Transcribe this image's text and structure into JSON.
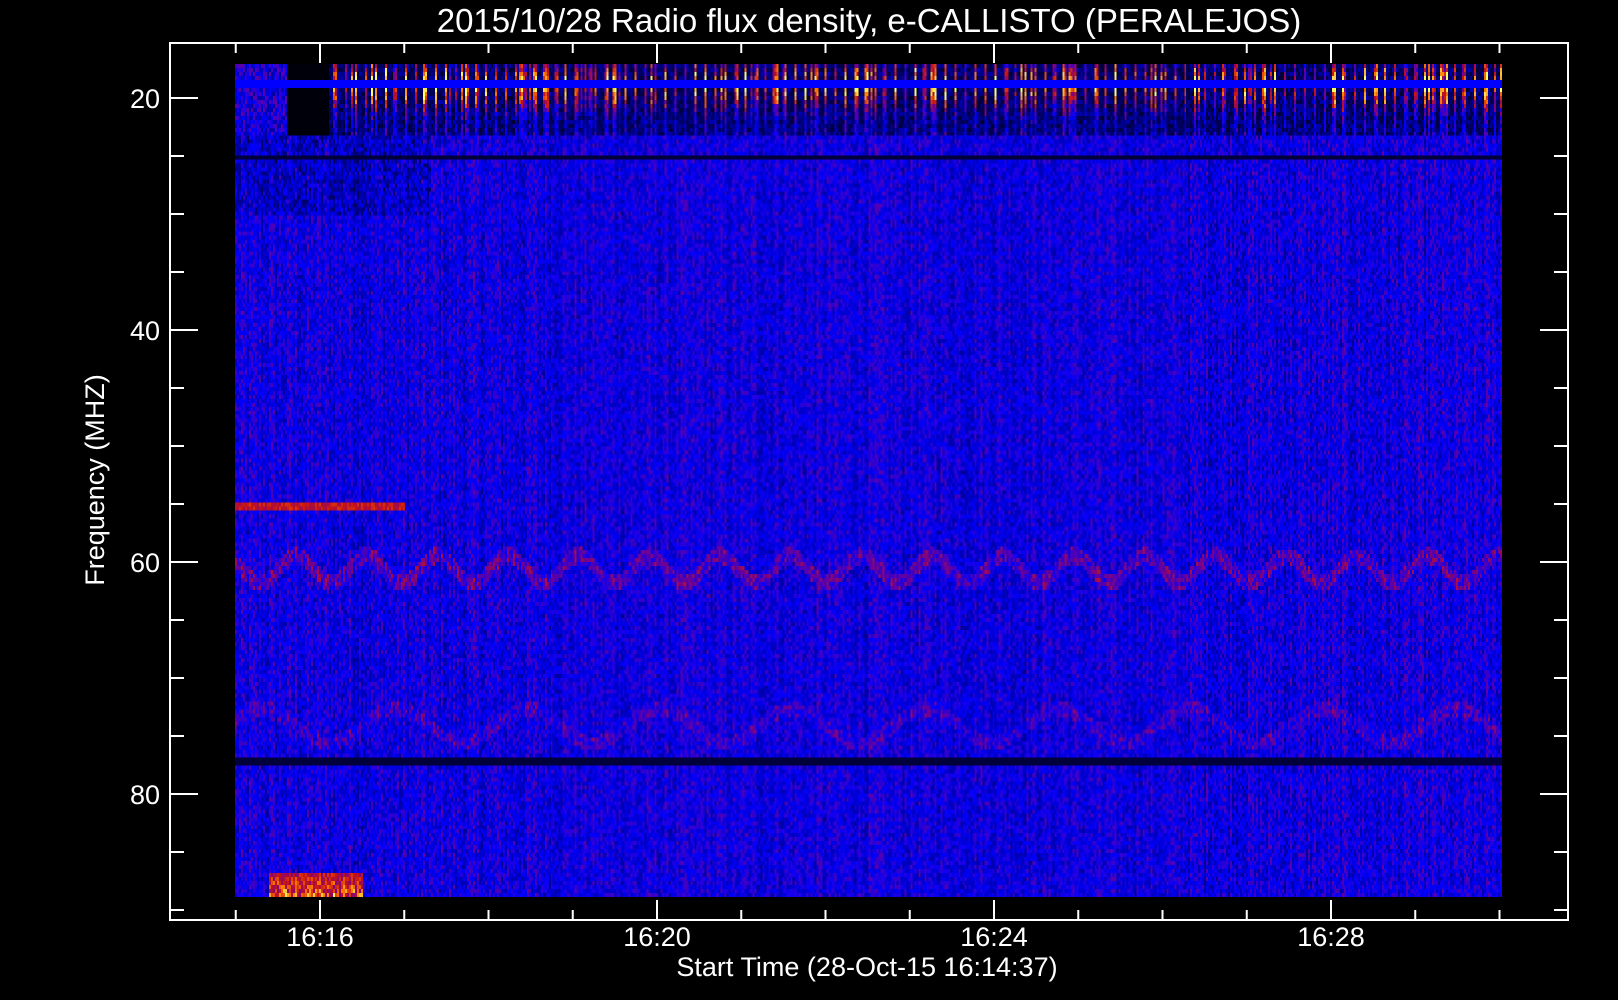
{
  "chart_data": {
    "type": "heatmap",
    "title": "2015/10/28  Radio flux density, e-CALLISTO (PERALEJOS)",
    "xlabel": "Start Time (28-Oct-15 16:14:37)",
    "ylabel": "Frequency (MHZ)",
    "x_tick_labels": [
      "16:16",
      "16:20",
      "16:24",
      "16:28"
    ],
    "x_major_ticks_min": [
      16,
      20,
      24,
      28
    ],
    "x_minor_ticks_min": [
      15,
      17,
      18,
      19,
      21,
      22,
      23,
      25,
      26,
      27,
      29,
      30
    ],
    "x_range_min_after_1600": [
      14.22,
      30.78
    ],
    "data_x_range_min_after_1600": [
      15.0,
      30.0
    ],
    "y_tick_labels": [
      "20",
      "40",
      "60",
      "80"
    ],
    "y_major_ticks": [
      20,
      40,
      60,
      80
    ],
    "y_minor_ticks": [
      25,
      30,
      35,
      45,
      50,
      55,
      65,
      70,
      75,
      85,
      90
    ],
    "ylim": [
      90.9,
      16.2
    ],
    "data_y_range": [
      17.1,
      88.9
    ],
    "y_inverted": true,
    "grid": false,
    "colormap": [
      "#000000",
      "#00007a",
      "#0000ff",
      "#6e0096",
      "#c81414",
      "#ff7800",
      "#ffff64"
    ],
    "features": {
      "burst_band_mhz": [
        17.1,
        23.0
      ],
      "burst_start_min": 16.1,
      "constant_line_mhz": 18.6,
      "dark_line_mhz": [
        25.0,
        77.0
      ],
      "wavy_band_mhz": 60.5,
      "interference_line_mhz": 55.0,
      "low_end_burst_mhz": [
        86.5,
        88.9
      ],
      "low_end_burst_min": [
        15.4,
        16.5
      ]
    }
  }
}
